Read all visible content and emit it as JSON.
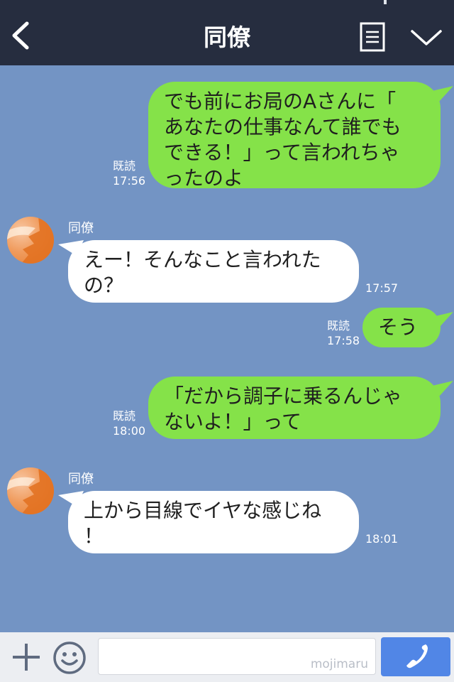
{
  "header": {
    "title": "同僚"
  },
  "messages": [
    {
      "side": "me",
      "text_lines": [
        "でも前にお局のAさんに「",
        "あなたの仕事なんて誰でも",
        "できる！」って言われちゃ",
        "ったのよ"
      ],
      "read": "既読",
      "time": "17:56"
    },
    {
      "side": "them",
      "sender": "同僚",
      "text_lines": [
        "えー！そんなこと言われた",
        "の？"
      ],
      "time": "17:57"
    },
    {
      "side": "me",
      "text_lines": [
        "そう"
      ],
      "read": "既読",
      "time": "17:58"
    },
    {
      "side": "me",
      "text_lines": [
        "「だから調子に乗るんじゃ",
        "ないよ！」って"
      ],
      "read": "既読",
      "time": "18:00"
    },
    {
      "side": "them",
      "sender": "同僚",
      "text_lines": [
        "上から目線でイヤな感じね",
        "！"
      ],
      "time": "18:01"
    }
  ],
  "input": {
    "value": "",
    "watermark": "mojimaru"
  },
  "colors": {
    "header_bg": "#262d3f",
    "chat_bg": "#7394c4",
    "my_bubble": "#85e249",
    "their_bubble": "#ffffff",
    "call_button": "#5186e6"
  },
  "icons": [
    "back-arrow",
    "notes",
    "chevron-down",
    "plus",
    "smiley",
    "phone"
  ]
}
